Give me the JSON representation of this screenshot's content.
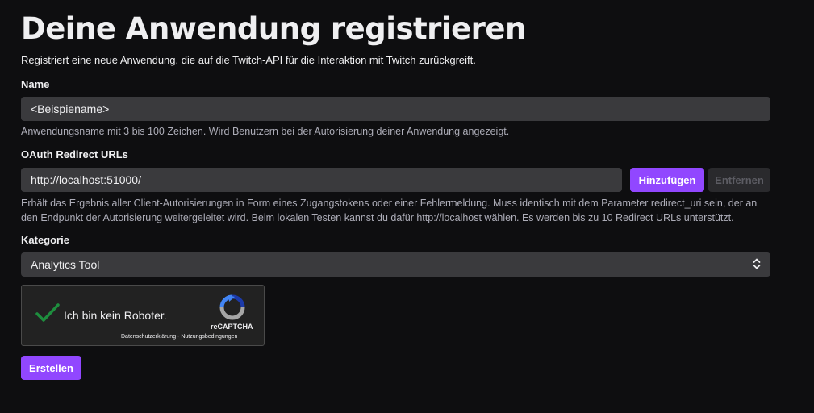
{
  "page": {
    "title": "Deine Anwendung registrieren",
    "subtitle": "Registriert eine neue Anwendung, die auf die Twitch-API für die Interaktion mit Twitch zurückgreift."
  },
  "name_field": {
    "label": "Name",
    "value": "<Beispiename>",
    "help": "Anwendungsname mit 3 bis 100 Zeichen. Wird Benutzern bei der Autorisierung deiner Anwendung angezeigt."
  },
  "redirect_field": {
    "label": "OAuth Redirect URLs",
    "value": "http://localhost:51000/",
    "add_label": "Hinzufügen",
    "remove_label": "Entfernen",
    "help_line1": "Erhält das Ergebnis aller Client-Autorisierungen in Form eines Zugangstokens oder einer Fehlermeldung. Muss identisch mit dem Parameter redirect_uri sein, der an",
    "help_line2": "den Endpunkt der Autorisierung weitergeleitet wird. Beim lokalen Testen kannst du dafür http://localhost wählen. Es werden bis zu 10 Redirect URLs unterstützt."
  },
  "category_field": {
    "label": "Kategorie",
    "selected": "Analytics Tool",
    "chevron_icon": "chevron-up-down-icon"
  },
  "captcha": {
    "text": "Ich bin kein Roboter.",
    "brand": "reCAPTCHA",
    "links": "Datenschutzerklärung - Nutzungsbedingungen",
    "check_color": "#1e8e3e"
  },
  "submit": {
    "label": "Erstellen"
  },
  "colors": {
    "accent": "#9147ff",
    "background": "#0e0e10",
    "input": "#3a3a3d"
  }
}
